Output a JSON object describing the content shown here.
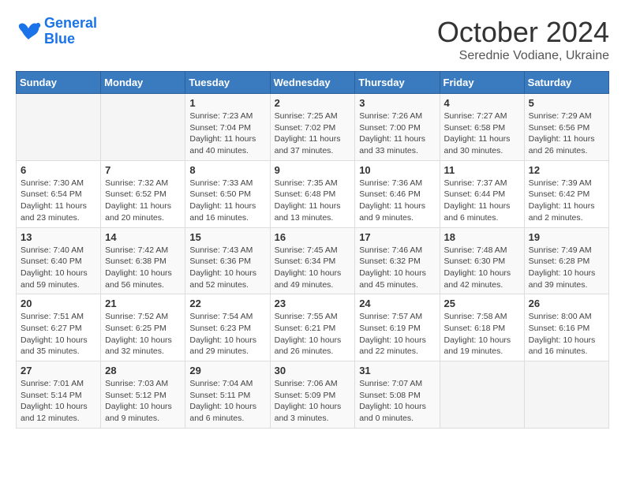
{
  "logo": {
    "line1": "General",
    "line2": "Blue"
  },
  "title": "October 2024",
  "subtitle": "Serednie Vodiane, Ukraine",
  "weekdays": [
    "Sunday",
    "Monday",
    "Tuesday",
    "Wednesday",
    "Thursday",
    "Friday",
    "Saturday"
  ],
  "weeks": [
    [
      {
        "day": "",
        "info": ""
      },
      {
        "day": "",
        "info": ""
      },
      {
        "day": "1",
        "info": "Sunrise: 7:23 AM\nSunset: 7:04 PM\nDaylight: 11 hours and 40 minutes."
      },
      {
        "day": "2",
        "info": "Sunrise: 7:25 AM\nSunset: 7:02 PM\nDaylight: 11 hours and 37 minutes."
      },
      {
        "day": "3",
        "info": "Sunrise: 7:26 AM\nSunset: 7:00 PM\nDaylight: 11 hours and 33 minutes."
      },
      {
        "day": "4",
        "info": "Sunrise: 7:27 AM\nSunset: 6:58 PM\nDaylight: 11 hours and 30 minutes."
      },
      {
        "day": "5",
        "info": "Sunrise: 7:29 AM\nSunset: 6:56 PM\nDaylight: 11 hours and 26 minutes."
      }
    ],
    [
      {
        "day": "6",
        "info": "Sunrise: 7:30 AM\nSunset: 6:54 PM\nDaylight: 11 hours and 23 minutes."
      },
      {
        "day": "7",
        "info": "Sunrise: 7:32 AM\nSunset: 6:52 PM\nDaylight: 11 hours and 20 minutes."
      },
      {
        "day": "8",
        "info": "Sunrise: 7:33 AM\nSunset: 6:50 PM\nDaylight: 11 hours and 16 minutes."
      },
      {
        "day": "9",
        "info": "Sunrise: 7:35 AM\nSunset: 6:48 PM\nDaylight: 11 hours and 13 minutes."
      },
      {
        "day": "10",
        "info": "Sunrise: 7:36 AM\nSunset: 6:46 PM\nDaylight: 11 hours and 9 minutes."
      },
      {
        "day": "11",
        "info": "Sunrise: 7:37 AM\nSunset: 6:44 PM\nDaylight: 11 hours and 6 minutes."
      },
      {
        "day": "12",
        "info": "Sunrise: 7:39 AM\nSunset: 6:42 PM\nDaylight: 11 hours and 2 minutes."
      }
    ],
    [
      {
        "day": "13",
        "info": "Sunrise: 7:40 AM\nSunset: 6:40 PM\nDaylight: 10 hours and 59 minutes."
      },
      {
        "day": "14",
        "info": "Sunrise: 7:42 AM\nSunset: 6:38 PM\nDaylight: 10 hours and 56 minutes."
      },
      {
        "day": "15",
        "info": "Sunrise: 7:43 AM\nSunset: 6:36 PM\nDaylight: 10 hours and 52 minutes."
      },
      {
        "day": "16",
        "info": "Sunrise: 7:45 AM\nSunset: 6:34 PM\nDaylight: 10 hours and 49 minutes."
      },
      {
        "day": "17",
        "info": "Sunrise: 7:46 AM\nSunset: 6:32 PM\nDaylight: 10 hours and 45 minutes."
      },
      {
        "day": "18",
        "info": "Sunrise: 7:48 AM\nSunset: 6:30 PM\nDaylight: 10 hours and 42 minutes."
      },
      {
        "day": "19",
        "info": "Sunrise: 7:49 AM\nSunset: 6:28 PM\nDaylight: 10 hours and 39 minutes."
      }
    ],
    [
      {
        "day": "20",
        "info": "Sunrise: 7:51 AM\nSunset: 6:27 PM\nDaylight: 10 hours and 35 minutes."
      },
      {
        "day": "21",
        "info": "Sunrise: 7:52 AM\nSunset: 6:25 PM\nDaylight: 10 hours and 32 minutes."
      },
      {
        "day": "22",
        "info": "Sunrise: 7:54 AM\nSunset: 6:23 PM\nDaylight: 10 hours and 29 minutes."
      },
      {
        "day": "23",
        "info": "Sunrise: 7:55 AM\nSunset: 6:21 PM\nDaylight: 10 hours and 26 minutes."
      },
      {
        "day": "24",
        "info": "Sunrise: 7:57 AM\nSunset: 6:19 PM\nDaylight: 10 hours and 22 minutes."
      },
      {
        "day": "25",
        "info": "Sunrise: 7:58 AM\nSunset: 6:18 PM\nDaylight: 10 hours and 19 minutes."
      },
      {
        "day": "26",
        "info": "Sunrise: 8:00 AM\nSunset: 6:16 PM\nDaylight: 10 hours and 16 minutes."
      }
    ],
    [
      {
        "day": "27",
        "info": "Sunrise: 7:01 AM\nSunset: 5:14 PM\nDaylight: 10 hours and 12 minutes."
      },
      {
        "day": "28",
        "info": "Sunrise: 7:03 AM\nSunset: 5:12 PM\nDaylight: 10 hours and 9 minutes."
      },
      {
        "day": "29",
        "info": "Sunrise: 7:04 AM\nSunset: 5:11 PM\nDaylight: 10 hours and 6 minutes."
      },
      {
        "day": "30",
        "info": "Sunrise: 7:06 AM\nSunset: 5:09 PM\nDaylight: 10 hours and 3 minutes."
      },
      {
        "day": "31",
        "info": "Sunrise: 7:07 AM\nSunset: 5:08 PM\nDaylight: 10 hours and 0 minutes."
      },
      {
        "day": "",
        "info": ""
      },
      {
        "day": "",
        "info": ""
      }
    ]
  ]
}
